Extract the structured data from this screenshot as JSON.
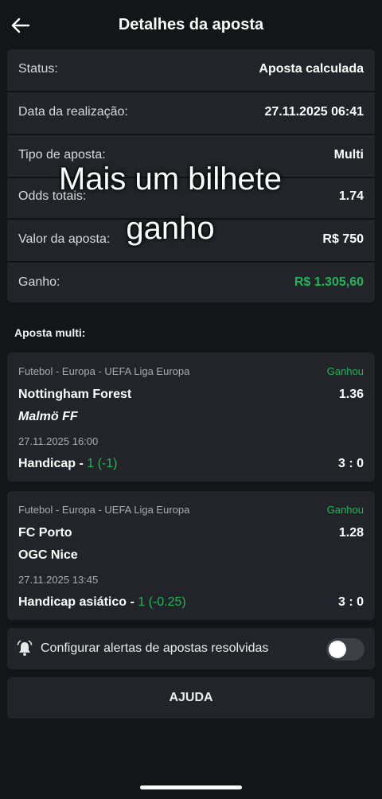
{
  "header": {
    "title": "Detalhes da aposta"
  },
  "details": [
    {
      "label": "Status:",
      "value": "Aposta calculada"
    },
    {
      "label": "Data da realização:",
      "value": "27.11.2025 06:41"
    },
    {
      "label": "Tipo de aposta:",
      "value": "Multi"
    },
    {
      "label": "Odds totais:",
      "value": "1.74"
    },
    {
      "label": "Valor da aposta:",
      "value": "R$ 750"
    },
    {
      "label": "Ganho:",
      "value": "R$ 1.305,60"
    }
  ],
  "overlay_text": "Mais um bilhete ganho",
  "section_label": "Aposta multi:",
  "events": [
    {
      "league": "Futebol - Europa - UEFA Liga Europa",
      "result": "Ganhou",
      "team1": "Nottingham Forest",
      "odd": "1.36",
      "team2": "Malmö FF",
      "date": "27.11.2025 16:00",
      "market": "Handicap -",
      "market_value": "1 (-1)",
      "score": "3 : 0"
    },
    {
      "league": "Futebol - Europa - UEFA Liga Europa",
      "result": "Ganhou",
      "team1": "FC Porto",
      "odd": "1.28",
      "team2": "OGC Nice",
      "date": "27.11.2025 13:45",
      "market": "Handicap asiático -",
      "market_value": "1 (-0.25)",
      "score": "3 : 0"
    }
  ],
  "alerts": {
    "label": "Configurar alertas de apostas resolvidas",
    "enabled": false
  },
  "help": {
    "label": "AJUDA"
  },
  "colors": {
    "background": "#141518",
    "card": "#222429",
    "win_green": "#22b45a"
  }
}
